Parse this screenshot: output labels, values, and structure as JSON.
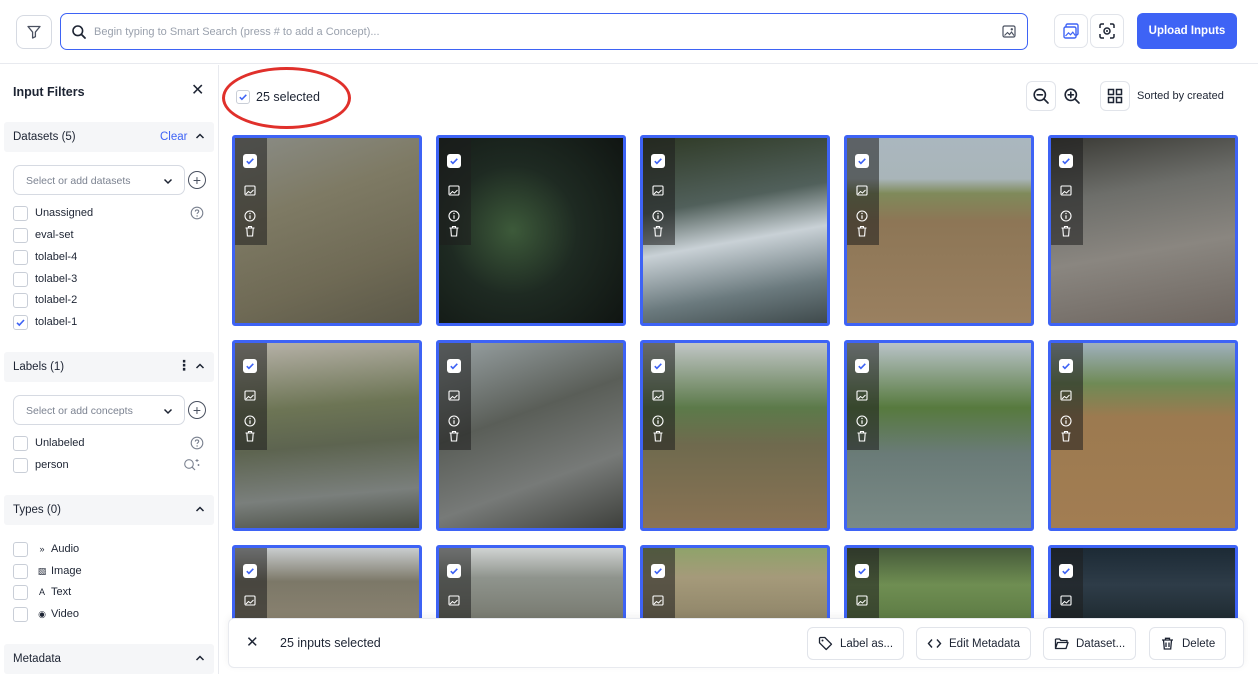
{
  "topbar": {
    "search_placeholder": "Begin typing to Smart Search (press # to add a Concept)...",
    "upload_label": "Upload Inputs"
  },
  "sidebar": {
    "title": "Input Filters",
    "datasets": {
      "header": "Datasets (5)",
      "clear_label": "Clear",
      "select_placeholder": "Select or add datasets",
      "items": [
        {
          "label": "Unassigned",
          "checked": false
        },
        {
          "label": "eval-set",
          "checked": false
        },
        {
          "label": "tolabel-4",
          "checked": false
        },
        {
          "label": "tolabel-3",
          "checked": false
        },
        {
          "label": "tolabel-2",
          "checked": false
        },
        {
          "label": "tolabel-1",
          "checked": true
        }
      ]
    },
    "labels": {
      "header": "Labels (1)",
      "select_placeholder": "Select or add concepts",
      "items": [
        {
          "label": "Unlabeled",
          "checked": false
        },
        {
          "label": "person",
          "checked": false
        }
      ]
    },
    "types": {
      "header": "Types (0)",
      "items": [
        {
          "label": "Audio",
          "glyph": "»"
        },
        {
          "label": "Image",
          "glyph": "▧"
        },
        {
          "label": "Text",
          "glyph": "A"
        },
        {
          "label": "Video",
          "glyph": "◉"
        }
      ]
    },
    "metadata": {
      "header": "Metadata"
    }
  },
  "main": {
    "selected_label": "25 selected",
    "sort_label": "Sorted by created"
  },
  "action_bar": {
    "count_label": "25 inputs selected",
    "label_as": "Label as...",
    "edit_metadata": "Edit Metadata",
    "dataset": "Dataset...",
    "delete": "Delete"
  },
  "colors": {
    "accent": "#3e63f5",
    "highlight_ring": "#e0302b"
  }
}
